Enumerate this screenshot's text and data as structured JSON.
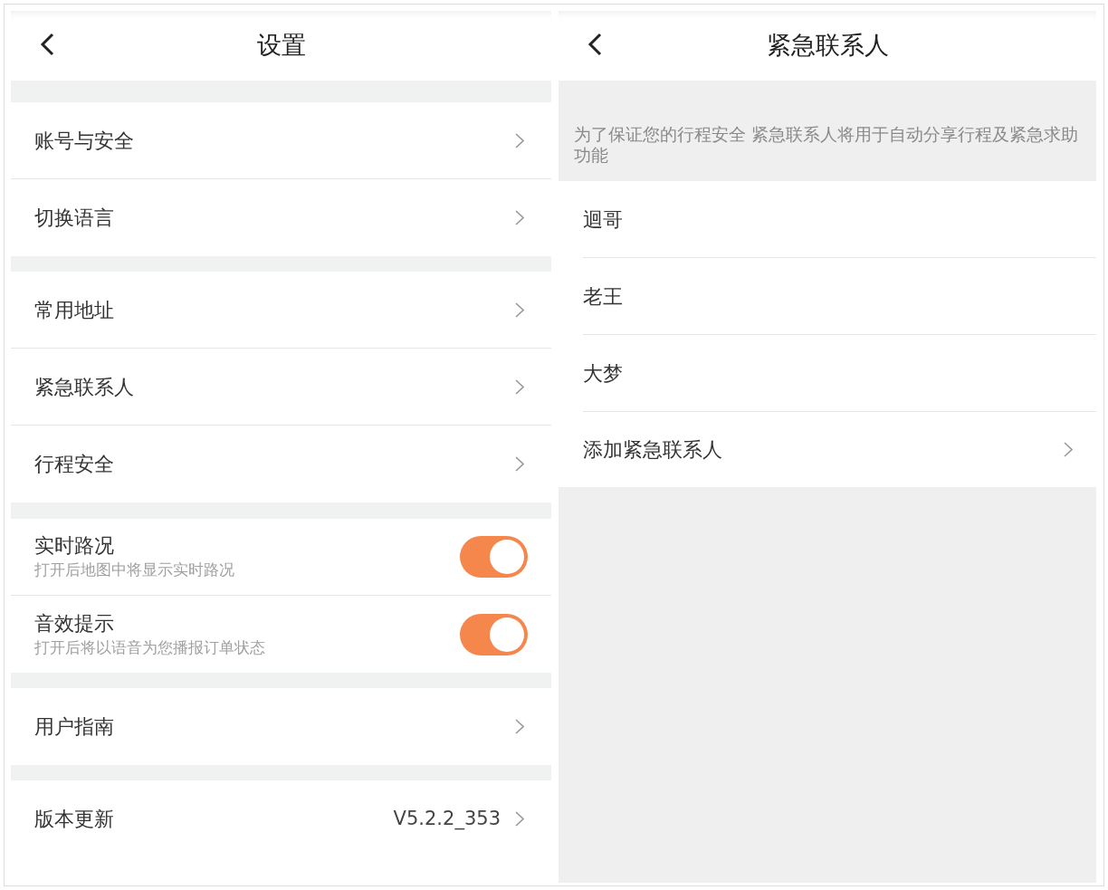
{
  "settings": {
    "title": "设置",
    "groups": [
      [
        {
          "kind": "link",
          "label": "账号与安全"
        },
        {
          "kind": "link",
          "label": "切换语言"
        }
      ],
      [
        {
          "kind": "link",
          "label": "常用地址"
        },
        {
          "kind": "link",
          "label": "紧急联系人"
        },
        {
          "kind": "link",
          "label": "行程安全"
        }
      ],
      [
        {
          "kind": "toggle",
          "label": "实时路况",
          "description": "打开后地图中将显示实时路况",
          "on": true
        },
        {
          "kind": "toggle",
          "label": "音效提示",
          "description": "打开后将以语音为您播报订单状态",
          "on": true
        }
      ],
      [
        {
          "kind": "link",
          "label": "用户指南"
        }
      ],
      [
        {
          "kind": "value",
          "label": "版本更新",
          "value": "V5.2.2_353"
        }
      ]
    ]
  },
  "contacts_page": {
    "title": "紧急联系人",
    "notice": "为了保证您的行程安全 紧急联系人将用于自动分享行程及紧急求助功能",
    "contacts": [
      {
        "name": "迴哥"
      },
      {
        "name": "老王"
      },
      {
        "name": "大梦"
      }
    ],
    "add_label": "添加紧急联系人"
  }
}
